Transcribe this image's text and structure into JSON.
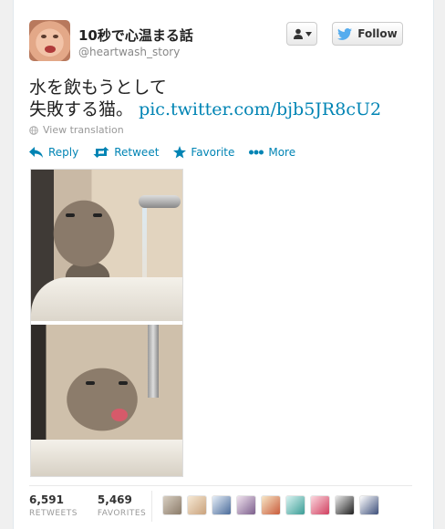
{
  "user": {
    "name": "10秒で心温まる話",
    "handle": "@heartwash_story"
  },
  "buttons": {
    "follow_label": "Follow"
  },
  "tweet": {
    "text_line1": "水を飲もうとして",
    "text_line2": "失敗する猫。",
    "link": "pic.twitter.com/bjb5JR8cU2",
    "translate": "View translation"
  },
  "actions": [
    {
      "label": "Reply",
      "icon": "reply-icon"
    },
    {
      "label": "Retweet",
      "icon": "retweet-icon"
    },
    {
      "label": "Favorite",
      "icon": "star-icon"
    },
    {
      "label": "More",
      "icon": "more-dots-icon"
    }
  ],
  "stats": {
    "retweets_count": "6,591",
    "retweets_label": "RETWEETS",
    "favorites_count": "5,469",
    "favorites_label": "FAVORITES"
  },
  "colors": {
    "link": "#0084b4",
    "twitter_bird": "#55acee"
  },
  "favoriters_avatars": 10
}
